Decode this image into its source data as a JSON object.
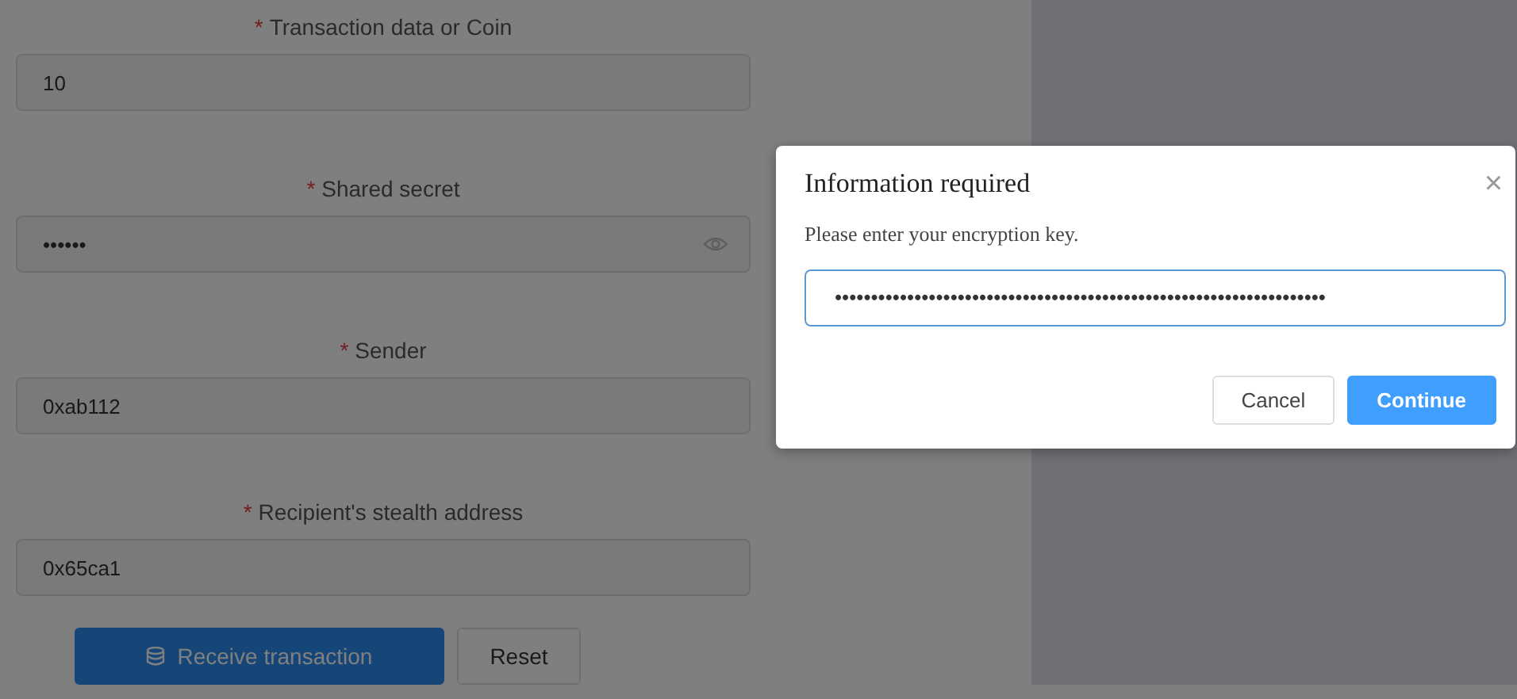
{
  "form": {
    "fields": [
      {
        "label": "Transaction data or Coin",
        "required_mark": "*",
        "kind": "text",
        "value": "10"
      },
      {
        "label": "Shared secret",
        "required_mark": "*",
        "kind": "password",
        "value": "••••••"
      },
      {
        "label": "Sender",
        "required_mark": "*",
        "kind": "text",
        "value": "0xab112"
      },
      {
        "label": "Recipient's stealth address",
        "required_mark": "*",
        "kind": "text",
        "value": "0x65ca1"
      }
    ],
    "buttons": [
      {
        "label": "Receive transaction",
        "kind": "primary"
      },
      {
        "label": "Reset",
        "kind": "default"
      }
    ]
  },
  "dialog": {
    "title": "Information required",
    "close": "×",
    "message": "Please enter your encryption key.",
    "input_value": "••••••••••••••••••••••••••••••••••••••••••••••••••••••••••••••••••••",
    "buttons": [
      {
        "label": "Cancel",
        "kind": "default"
      },
      {
        "label": "Continue",
        "kind": "primary"
      }
    ]
  }
}
